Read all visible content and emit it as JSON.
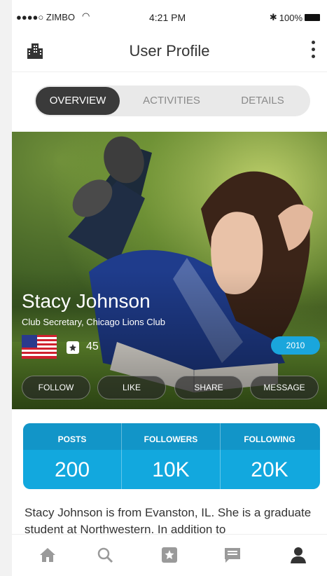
{
  "status_bar": {
    "carrier": "●●●●○ ZIMBO",
    "time": "4:21 PM",
    "battery": "100%"
  },
  "nav": {
    "title": "User Profile"
  },
  "tabs": [
    {
      "label": "OVERVIEW",
      "active": true
    },
    {
      "label": "ACTIVITIES",
      "active": false
    },
    {
      "label": "DETAILS",
      "active": false
    }
  ],
  "profile": {
    "name": "Stacy Johnson",
    "subtitle": "Club Secretary, Chicago Lions Club",
    "badge_count": "45",
    "year": "2010"
  },
  "actions": [
    "FOLLOW",
    "LIKE",
    "SHARE",
    "MESSAGE"
  ],
  "stats": [
    {
      "label": "POSTS",
      "value": "200"
    },
    {
      "label": "FOLLOWERS",
      "value": "10K"
    },
    {
      "label": "FOLLOWING",
      "value": "20K"
    }
  ],
  "bio": "Stacy Johnson is from Evanston, IL. She is a graduate student at Northwestern. In addition to",
  "tab_bar": [
    "home-icon",
    "search-icon",
    "badge-icon",
    "chat-icon",
    "person-icon"
  ],
  "colors": {
    "accent": "#12a8de",
    "tab_active": "#3a3a3a"
  }
}
